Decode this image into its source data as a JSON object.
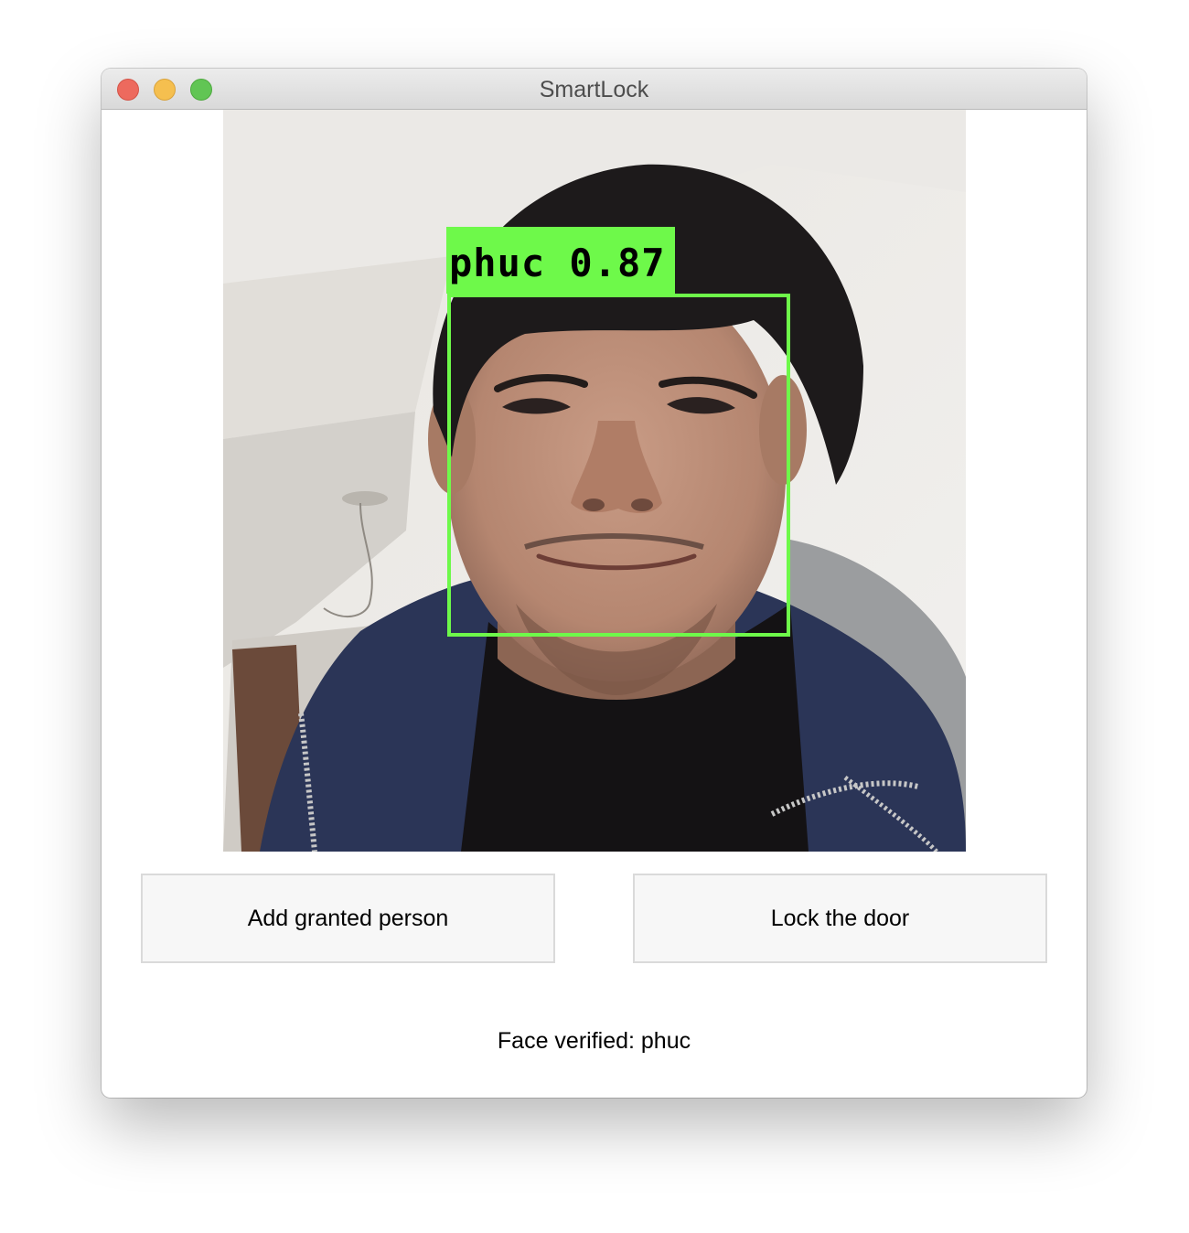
{
  "window": {
    "title": "SmartLock"
  },
  "camera": {
    "detection": {
      "label": "phuc 0.87"
    }
  },
  "actions": {
    "add_label": "Add granted person",
    "lock_label": "Lock the door"
  },
  "status": {
    "text": "Face verified: phuc"
  },
  "colors": {
    "detection_green": "#6ef94a",
    "close": "#ed6a5e",
    "minimize": "#f5bf4f",
    "zoom": "#61c554"
  }
}
